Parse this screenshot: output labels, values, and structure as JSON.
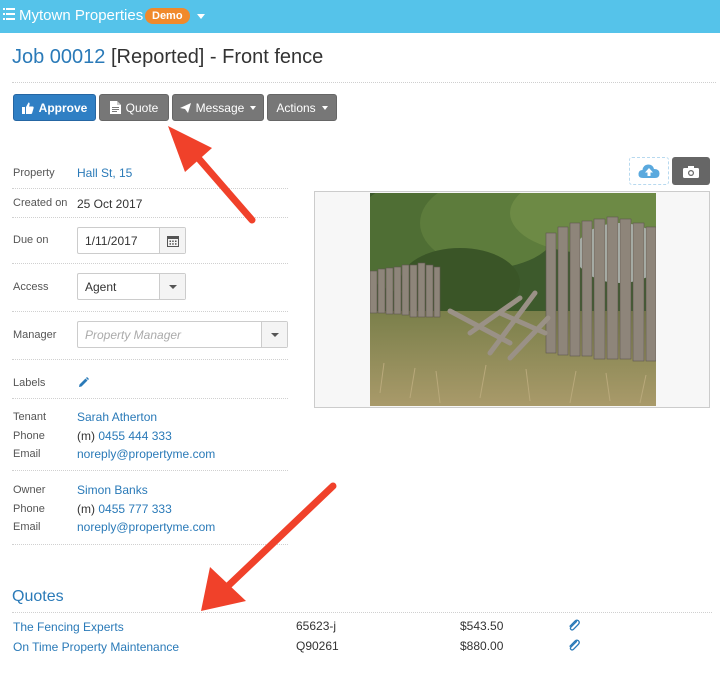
{
  "header": {
    "app_title": "Mytown Properties",
    "badge": "Demo"
  },
  "job": {
    "number": "Job 00012",
    "rest": " [Reported] - Front fence"
  },
  "toolbar": {
    "approve": "Approve",
    "quote": "Quote",
    "message": "Message",
    "actions": "Actions"
  },
  "details": {
    "property_label": "Property",
    "property_value": "Hall St, 15",
    "created_label": "Created on",
    "created_value": "25 Oct 2017",
    "due_label": "Due on",
    "due_value": "1/11/2017",
    "access_label": "Access",
    "access_value": "Agent",
    "manager_label": "Manager",
    "manager_placeholder": "Property Manager",
    "labels_label": "Labels"
  },
  "tenant": {
    "label": "Tenant",
    "name": "Sarah Atherton",
    "phone_label": "Phone",
    "phone_prefix": "(m)",
    "phone": "0455 444 333",
    "email_label": "Email",
    "email": "noreply@propertyme.com"
  },
  "owner": {
    "label": "Owner",
    "name": "Simon Banks",
    "phone_label": "Phone",
    "phone_prefix": "(m)",
    "phone": "0455 777 333",
    "email_label": "Email",
    "email": "noreply@propertyme.com"
  },
  "quotes": {
    "title": "Quotes",
    "rows": [
      {
        "supplier": "The Fencing Experts",
        "ref": "65623-j",
        "amount": "$543.50"
      },
      {
        "supplier": "On Time Property Maintenance",
        "ref": "Q90261",
        "amount": "$880.00"
      }
    ]
  },
  "icons": {
    "menu": "list-icon",
    "approve": "thumbs-up-icon",
    "quote": "document-icon",
    "message": "paper-plane-icon",
    "calendar": "calendar-icon",
    "labels": "pencil-icon",
    "upload": "cloud-upload-icon",
    "camera": "camera-icon",
    "attachment": "paperclip-icon"
  },
  "colors": {
    "topbar": "#55c3ea",
    "badge": "#f08a2c",
    "primary": "#2f7fc4",
    "link": "#2a7ab8",
    "secondary_button": "#777777",
    "annotation_arrow": "#f0412a"
  }
}
